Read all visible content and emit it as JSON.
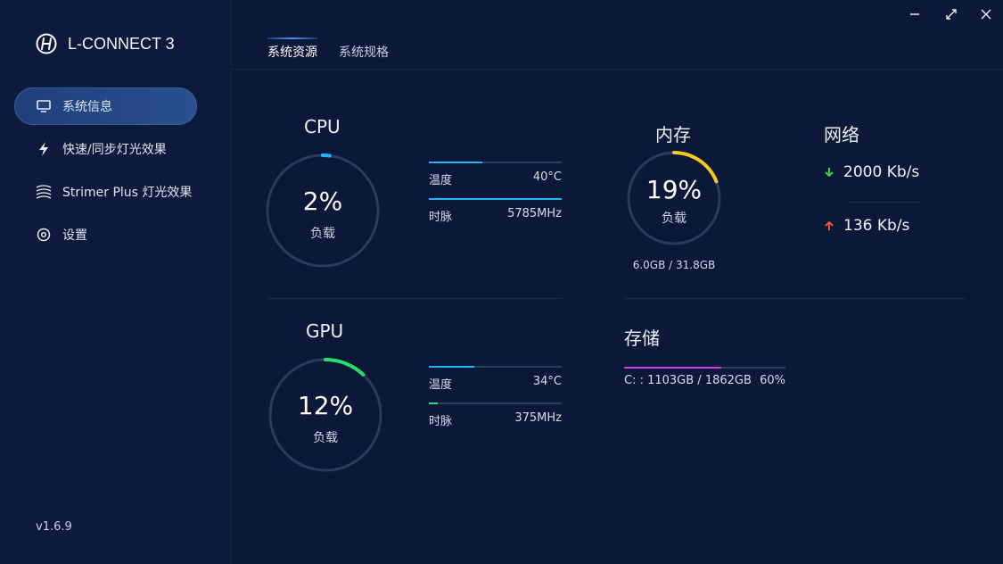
{
  "app": {
    "title": "L-CONNECT 3",
    "version": "v1.6.9"
  },
  "window_controls": {
    "minimize_icon": "minimize-icon",
    "maximize_icon": "maximize-icon",
    "close_icon": "close-icon"
  },
  "sidebar": {
    "items": [
      {
        "label": "系统信息",
        "icon": "monitor-icon",
        "active": true
      },
      {
        "label": "快速/同步灯光效果",
        "icon": "lightning-icon",
        "active": false
      },
      {
        "label": "Strimer Plus 灯光效果",
        "icon": "strimer-icon",
        "active": false
      },
      {
        "label": "设置",
        "icon": "gear-icon",
        "active": false
      }
    ]
  },
  "tabs": [
    {
      "label": "系统资源",
      "active": true
    },
    {
      "label": "系统规格",
      "active": false
    }
  ],
  "cpu": {
    "title": "CPU",
    "load": "2%",
    "load_fraction": 0.02,
    "load_label": "负载",
    "temp_label": "温度",
    "temp_value": "40°C",
    "temp_fraction": 0.4,
    "clock_label": "时脉",
    "clock_value": "5785MHz",
    "clock_fraction": 1.0
  },
  "gpu": {
    "title": "GPU",
    "load": "12%",
    "load_fraction": 0.12,
    "load_label": "负载",
    "temp_label": "温度",
    "temp_value": "34°C",
    "temp_fraction": 0.34,
    "clock_label": "时脉",
    "clock_value": "375MHz",
    "clock_fraction": 0.07
  },
  "memory": {
    "title": "内存",
    "load": "19%",
    "load_fraction": 0.19,
    "load_label": "负载",
    "capacity": "6.0GB / 31.8GB"
  },
  "network": {
    "title": "网络",
    "download": "2000 Kb/s",
    "upload": "136 Kb/s"
  },
  "storage": {
    "title": "存储",
    "drive_text": "C: : 1103GB / 1862GB",
    "percent": "60%",
    "fraction": 0.6
  },
  "colors": {
    "cpu_accent": "#1fb8f0",
    "gpu_accent": "#22e06a",
    "mem_accent": "#f2cc1c",
    "storage_accent": "#c93ee6",
    "download_arrow": "#3fd14a",
    "upload_arrow": "#f0522d"
  }
}
